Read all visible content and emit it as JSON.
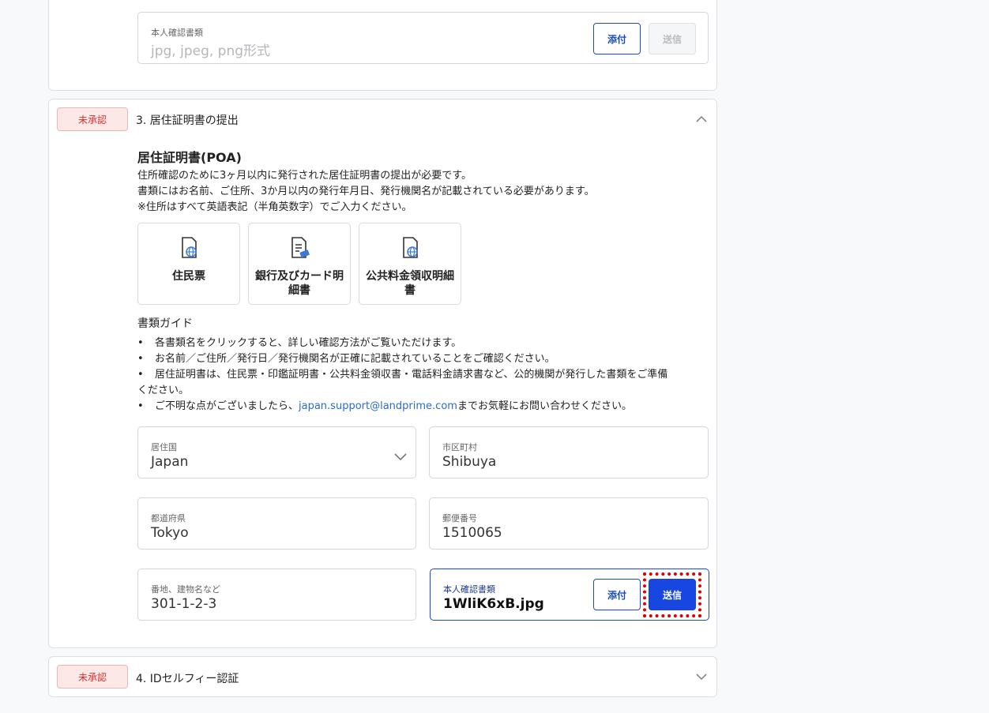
{
  "top_section": {
    "field_label": "本人確認書類",
    "field_placeholder": "jpg, jpeg, png形式",
    "attach_label": "添付",
    "send_label": "送信"
  },
  "section3": {
    "status": "未承認",
    "title": "3. 居住証明書の提出",
    "heading": "居住証明書(POA)",
    "desc": [
      "住所確認のために3ヶ月以内に発行された居住証明書の提出が必要です。",
      "書類にはお名前、ご住所、3か月以内の発行年月日、発行機関名が記載されている必要があります。",
      "※住所はすべて英語表記（半角英数字）でご入力ください。"
    ],
    "doc_cards": [
      {
        "label": "住民票",
        "icon": "document-globe-icon"
      },
      {
        "label": "銀行及びカード明細書",
        "icon": "document-card-icon"
      },
      {
        "label": "公共料金領収明細書",
        "icon": "document-globe-icon"
      }
    ],
    "guide_title": "書類ガイド",
    "guide_items": [
      "各書類名をクリックすると、詳しい確認方法がご覧いただけます。",
      "お名前／ご住所／発行日／発行機関名が正確に記載されていることをご確認ください。",
      "居住証明書は、住民票・印鑑証明書・公共料金領収書・電話料金請求書など、公的機関が発行した書類をご準備",
      "ください。",
      "ご不明な点がございましたら、",
      "japan.support@landprime.com",
      "までお気軽にお問い合わせください。"
    ],
    "fields": {
      "country": {
        "label": "居住国",
        "value": "Japan"
      },
      "city": {
        "label": "市区町村",
        "value": "Shibuya"
      },
      "prefecture": {
        "label": "都道府県",
        "value": "Tokyo"
      },
      "postal": {
        "label": "郵便番号",
        "value": "1510065"
      },
      "address": {
        "label": "番地、建物名など",
        "value": "301-1-2-3"
      },
      "document": {
        "label": "本人確認書類",
        "value": "1WliK6xB.jpg"
      }
    },
    "attach_label": "添付",
    "send_label": "送信"
  },
  "section4": {
    "status": "未承認",
    "title": "4. IDセルフィー認証"
  },
  "colors": {
    "primary": "#1746e0",
    "badge_red": "#d32f2f",
    "highlight": "#e00000"
  }
}
